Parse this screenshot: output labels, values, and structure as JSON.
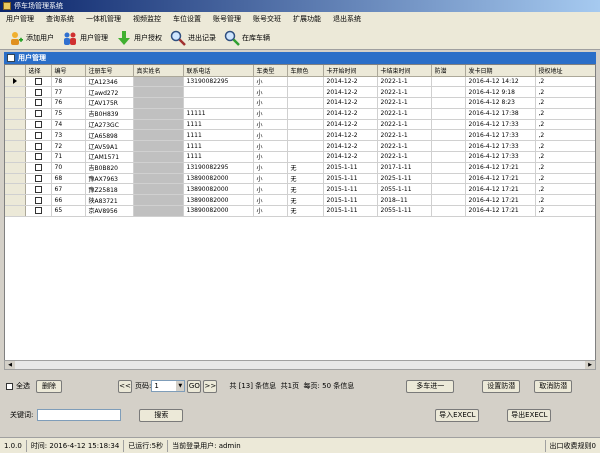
{
  "window": {
    "title": "停车场管理系统"
  },
  "menu": [
    "用户管理",
    "查询系统",
    "一体机管理",
    "视频监控",
    "车位设置",
    "账号管理",
    "账号交班",
    "扩展功能",
    "退出系统"
  ],
  "toolbar": [
    {
      "label": "添加用户",
      "icon": "add-user-icon"
    },
    {
      "label": "用户管理",
      "icon": "users-icon"
    },
    {
      "label": "用户授权",
      "icon": "down-arrow-icon"
    },
    {
      "label": "进出记录",
      "icon": "magnifier-icon"
    },
    {
      "label": "在库车辆",
      "icon": "magnifier-icon"
    }
  ],
  "panel": {
    "title": "用户管理"
  },
  "grid": {
    "columns": [
      "选择",
      "编号",
      "注册车号",
      "真实姓名",
      "联系电话",
      "车类型",
      "车颜色",
      "卡开始时间",
      "卡结束时间",
      "防潜",
      "发卡日期",
      "授权地址"
    ],
    "rows": [
      [
        "78",
        "辽A12346",
        "",
        "13190082295",
        "小",
        "",
        "2014-12-2",
        "2022-1-1",
        "",
        "2016-4-12 14:12",
        ",2"
      ],
      [
        "77",
        "辽awd272",
        "",
        "",
        "小",
        "",
        "2014-12-2",
        "2022-1-1",
        "",
        "2016-4-12 9:18",
        ",2"
      ],
      [
        "76",
        "辽AV175R",
        "",
        "",
        "小",
        "",
        "2014-12-2",
        "2022-1-1",
        "",
        "2016-4-12 8:23",
        ",2"
      ],
      [
        "75",
        "吉B0H839",
        "",
        "11111",
        "小",
        "",
        "2014-12-2",
        "2022-1-1",
        "",
        "2016-4-12 17:38",
        ",2"
      ],
      [
        "74",
        "辽A273GC",
        "",
        "1111",
        "小",
        "",
        "2014-12-2",
        "2022-1-1",
        "",
        "2016-4-12 17:33",
        ",2"
      ],
      [
        "73",
        "辽A65898",
        "",
        "1111",
        "小",
        "",
        "2014-12-2",
        "2022-1-1",
        "",
        "2016-4-12 17:33",
        ",2"
      ],
      [
        "72",
        "辽AV59A1",
        "",
        "1111",
        "小",
        "",
        "2014-12-2",
        "2022-1-1",
        "",
        "2016-4-12 17:33",
        ",2"
      ],
      [
        "71",
        "辽AM1571",
        "",
        "1111",
        "小",
        "",
        "2014-12-2",
        "2022-1-1",
        "",
        "2016-4-12 17:33",
        ",2"
      ],
      [
        "70",
        "吉B0B820",
        "",
        "13190082295",
        "小",
        "无",
        "2015-1-11",
        "2017-1-11",
        "",
        "2016-4-12 17:21",
        ",2"
      ],
      [
        "68",
        "豫AX7963",
        "",
        "13890082000",
        "小",
        "无",
        "2015-1-11",
        "2025-1-11",
        "",
        "2016-4-12 17:21",
        ",2"
      ],
      [
        "67",
        "豫Z25818",
        "",
        "13890082000",
        "小",
        "无",
        "2015-1-11",
        "2055-1-11",
        "",
        "2016-4-12 17:21",
        ",2"
      ],
      [
        "66",
        "陕A83721",
        "",
        "13890082000",
        "小",
        "无",
        "2015-1-11",
        "2018--11",
        "",
        "2016-4-12 17:21",
        ",2"
      ],
      [
        "65",
        "京AV8956",
        "",
        "13890082000",
        "小",
        "无",
        "2015-1-11",
        "2055-1-11",
        "",
        "2016-4-12 17:21",
        ",2"
      ]
    ]
  },
  "pager": {
    "select_all": "全选",
    "delete": "删除",
    "first": "<<",
    "page_label": "页码:",
    "page_value": "1",
    "go": "GO",
    "next": ">>",
    "info": "共 [13] 条信息  共1页  每页: 50 条信息",
    "multi_car": "多车进一",
    "set_anti": "设置防潜",
    "cancel_anti": "取消防潜"
  },
  "search": {
    "keyword_label": "关键词:",
    "value": "",
    "search_button": "搜索",
    "import_excel": "导入EXECL",
    "export_excel": "导出EXECL"
  },
  "status": {
    "version": "1.0.0",
    "time": "时间: 2016-4-12 15:18:34",
    "running": "已运行:5秒",
    "user": "当前登录用户: admin",
    "exit_mode": "出口收费规则0"
  }
}
